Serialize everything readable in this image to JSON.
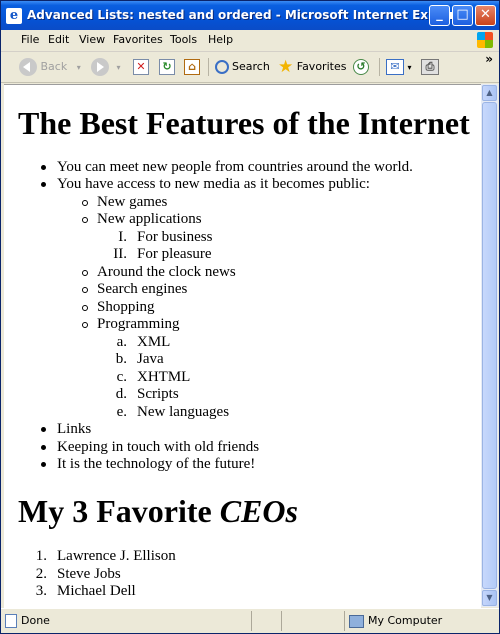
{
  "window": {
    "title": "Advanced Lists: nested and ordered - Microsoft Internet Explorer",
    "controls": {
      "minimize": "_",
      "maximize": "□",
      "close": "✕"
    }
  },
  "menu": [
    "File",
    "Edit",
    "View",
    "Favorites",
    "Tools",
    "Help"
  ],
  "toolbar": {
    "back_label": "Back",
    "search_label": "Search",
    "favorites_label": "Favorites"
  },
  "page": {
    "heading1": "The Best Features of the Internet",
    "features": {
      "item1": "You can meet new people from countries around the world.",
      "item2": "You have access to new media as it becomes public:",
      "sub": {
        "new_games": "New games",
        "new_applications": "New applications",
        "app_roman": [
          {
            "marker": "I.",
            "text": "For business"
          },
          {
            "marker": "II.",
            "text": "For pleasure"
          }
        ],
        "around_clock": "Around the clock news",
        "search_engines": "Search engines",
        "shopping": "Shopping",
        "programming": "Programming",
        "prog_alpha": [
          {
            "marker": "a.",
            "text": "XML"
          },
          {
            "marker": "b.",
            "text": "Java"
          },
          {
            "marker": "c.",
            "text": "XHTML"
          },
          {
            "marker": "d.",
            "text": "Scripts"
          },
          {
            "marker": "e.",
            "text": "New languages"
          }
        ]
      },
      "item3": "Links",
      "item4": "Keeping in touch with old friends",
      "item5": "It is the technology of the future!"
    },
    "heading2_prefix": "My 3 Favorite ",
    "heading2_em": "CEOs",
    "ceos": [
      {
        "marker": "1.",
        "text": "Lawrence J. Ellison"
      },
      {
        "marker": "2.",
        "text": "Steve Jobs"
      },
      {
        "marker": "3.",
        "text": "Michael Dell"
      }
    ]
  },
  "status": {
    "left": "Done",
    "right": "My Computer"
  }
}
